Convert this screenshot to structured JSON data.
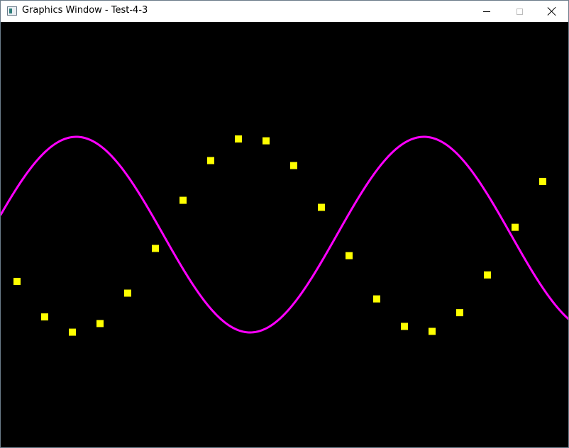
{
  "window": {
    "title": "Graphics Window - Test-4-3",
    "icon": "app-window-icon",
    "controls": {
      "minimize": "minimize-icon",
      "maximize": "maximize-icon",
      "close": "close-icon"
    }
  },
  "canvas": {
    "background": "#000000",
    "curve_color": "#ff00ff",
    "marker_color": "#ffff00",
    "marker_icon": "square-marker"
  },
  "plot": {
    "type": "line",
    "x": [
      0.5,
      1.0,
      1.5,
      2.0,
      2.5,
      3.0,
      3.5,
      4.0,
      4.5,
      5.0,
      5.5,
      6.0,
      6.5,
      7.0,
      7.5,
      8.0,
      8.5,
      9.0,
      9.5,
      10.0
    ],
    "y": [
      -0.478,
      -0.841,
      -0.997,
      -0.909,
      -0.598,
      -0.141,
      0.351,
      0.757,
      0.978,
      0.959,
      0.706,
      0.279,
      -0.215,
      -0.657,
      -0.938,
      -0.989,
      -0.798,
      -0.412,
      0.075,
      0.544
    ]
  }
}
